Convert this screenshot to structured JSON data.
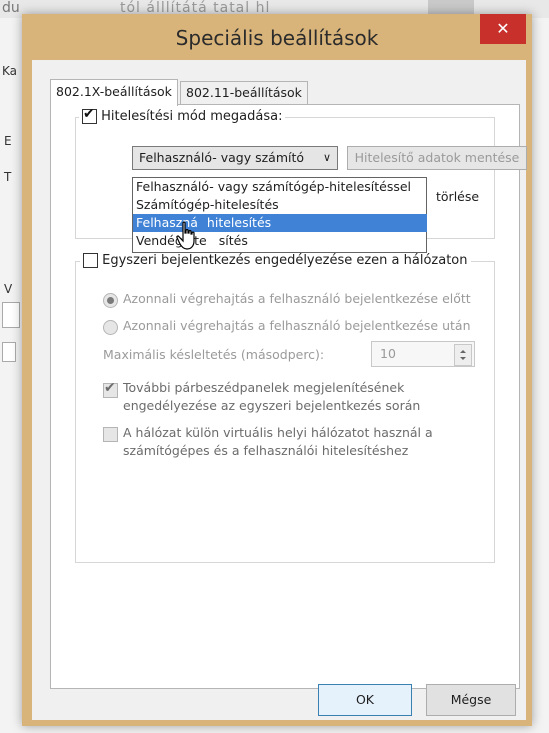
{
  "background": {
    "title_fragment_left": "du",
    "title_fragment_right": "tól    álllítátá    tatal   hl",
    "side_fragments": [
      "Ka",
      "E",
      "T",
      "V"
    ]
  },
  "dialog": {
    "title": "Speciális beállítások",
    "close_label": "✕"
  },
  "tabs": [
    {
      "label": "802.1X-beállítások",
      "active": true
    },
    {
      "label": "802.11-beállítások",
      "active": false
    }
  ],
  "auth_group": {
    "checkbox_label": "Hitelesítési mód megadása:",
    "checked": true,
    "selected_mode": "Felhasználó- vagy számító",
    "save_credentials_label": "Hitelesítő adatok mentése",
    "delete_label": "törlése",
    "dropdown_options": [
      "Felhasználó- vagy számítógép-hitelesítéssel",
      "Számítógép-hitelesítés",
      "Felhasználó-hitelesítés",
      "Vendéghitelesítés"
    ],
    "highlighted_index": 2,
    "highlighted_visible_text": "Felhaszná",
    "highlighted_visible_tail": "hitelesítés",
    "last_visible_head": "Vendéghite",
    "last_visible_tail": "sítés"
  },
  "sso_group": {
    "checkbox_label": "Egyszeri bejelentkezés engedélyezése ezen a hálózaton",
    "checked": false,
    "radio_before": "Azonnali végrehajtás a felhasználó bejelentkezése előtt",
    "radio_after": "Azonnali végrehajtás a felhasználó bejelentkezése után",
    "max_delay_label": "Maximális késleltetés (másodperc):",
    "max_delay_value": "10",
    "additional_dialogs_line1": "További párbeszédpanelek megjelenítésének",
    "additional_dialogs_line2": "engedélyezése az egyszeri bejelentkezés során",
    "vlan_line1": "A hálózat külön virtuális helyi hálózatot használ a",
    "vlan_line2": "számítógépes és a felhasználói hitelesítéshez"
  },
  "buttons": {
    "ok": "OK",
    "cancel": "Mégse"
  },
  "colors": {
    "dialog_frame": "#d8b47a",
    "close_button": "#c7302b",
    "selection": "#3f82d6"
  }
}
